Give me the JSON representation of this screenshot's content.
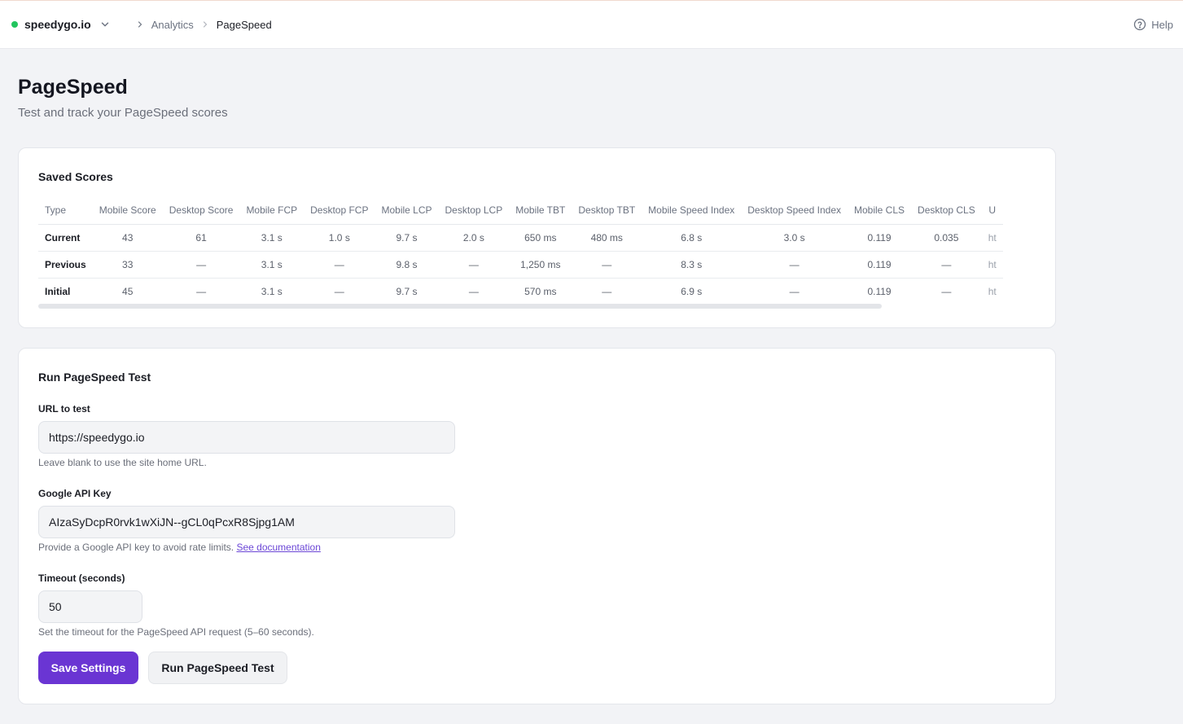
{
  "header": {
    "site_name": "speedygo.io",
    "status_color": "#22c55e",
    "breadcrumb": [
      "Analytics",
      "PageSpeed"
    ],
    "help_label": "Help"
  },
  "page": {
    "title": "PageSpeed",
    "subtitle": "Test and track your PageSpeed scores"
  },
  "saved_scores": {
    "title": "Saved Scores",
    "columns": [
      "Type",
      "Mobile Score",
      "Desktop Score",
      "Mobile FCP",
      "Desktop FCP",
      "Mobile LCP",
      "Desktop LCP",
      "Mobile TBT",
      "Desktop TBT",
      "Mobile Speed Index",
      "Desktop Speed Index",
      "Mobile CLS",
      "Desktop CLS",
      "U"
    ],
    "rows": [
      [
        "Current",
        "43",
        "61",
        "3.1 s",
        "1.0 s",
        "9.7 s",
        "2.0 s",
        "650 ms",
        "480 ms",
        "6.8 s",
        "3.0 s",
        "0.119",
        "0.035",
        "ht"
      ],
      [
        "Previous",
        "33",
        "—",
        "3.1 s",
        "—",
        "9.8 s",
        "—",
        "1,250 ms",
        "—",
        "8.3 s",
        "—",
        "0.119",
        "—",
        "ht"
      ],
      [
        "Initial",
        "45",
        "—",
        "3.1 s",
        "—",
        "9.7 s",
        "—",
        "570 ms",
        "—",
        "6.9 s",
        "—",
        "0.119",
        "—",
        "ht"
      ]
    ]
  },
  "run_test": {
    "title": "Run PageSpeed Test",
    "url": {
      "label": "URL to test",
      "value": "https://speedygo.io",
      "hint": "Leave blank to use the site home URL."
    },
    "api_key": {
      "label": "Google API Key",
      "value": "AIzaSyDcpR0rvk1wXiJN--gCL0qPcxR8Sjpg1AM",
      "hint": "Provide a Google API key to avoid rate limits.",
      "hint_link": "See documentation"
    },
    "timeout": {
      "label": "Timeout (seconds)",
      "value": "50",
      "hint": "Set the timeout for the PageSpeed API request (5–60 seconds)."
    },
    "save_label": "Save Settings",
    "run_label": "Run PageSpeed Test",
    "accent_color": "#6a35d3"
  }
}
